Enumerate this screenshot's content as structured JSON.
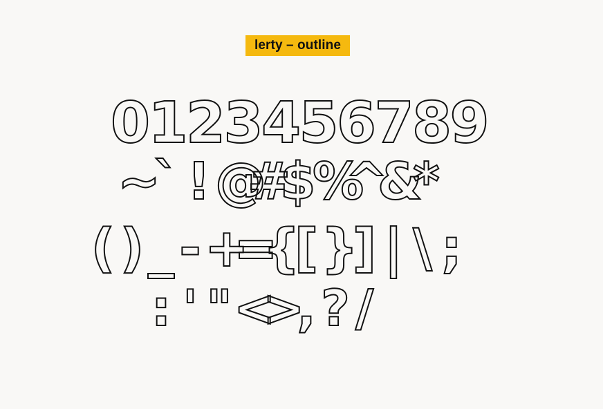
{
  "title": "lerty – outline",
  "colors": {
    "background": "#f9f8f6",
    "badge": "#f5b90f",
    "text": "#111111",
    "outline": "#111111"
  },
  "glyph_rows": [
    [
      "0",
      "1",
      "2",
      "3",
      "4",
      "5",
      "6",
      "7",
      "8",
      "9"
    ],
    [
      "~",
      "`",
      "!",
      "@",
      "#",
      "$",
      "%",
      "^",
      "&",
      "*"
    ],
    [
      "(",
      ")",
      "_",
      "-",
      "+",
      "=",
      "{",
      "[",
      "}",
      "]",
      "|",
      "\\",
      ";"
    ],
    [
      ":",
      "'",
      "\"",
      "<",
      ">",
      ",",
      "?",
      "/"
    ]
  ]
}
